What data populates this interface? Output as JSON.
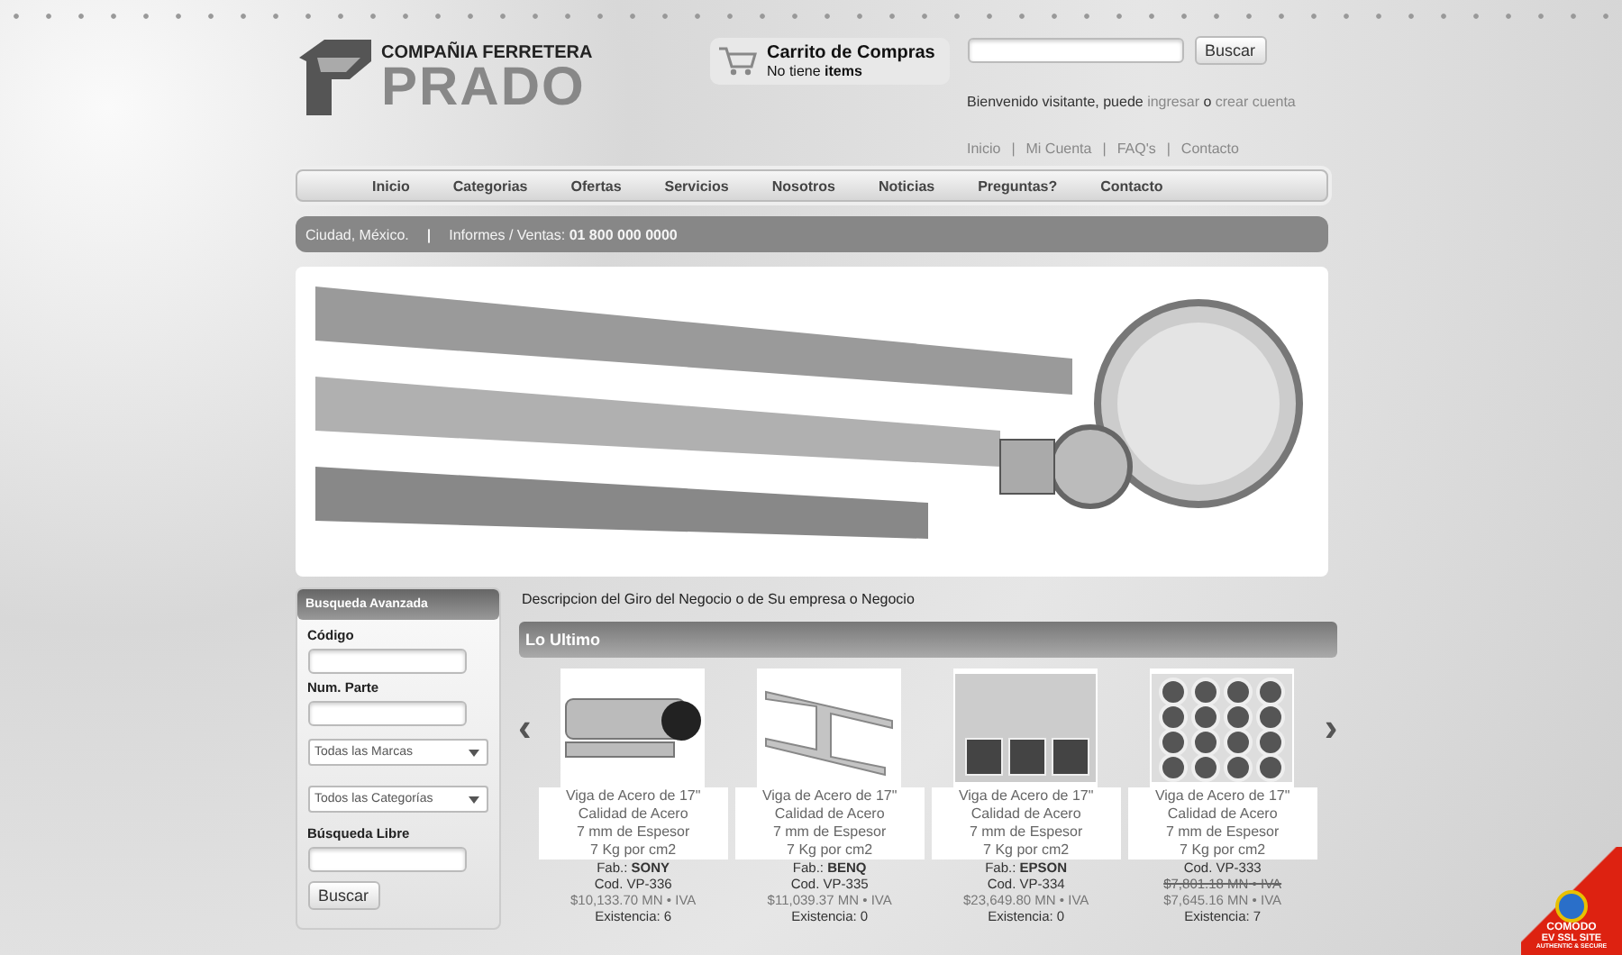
{
  "brand": {
    "line_1": "COMPAÑIA FERRETERA",
    "line_2": "PRADO"
  },
  "cart": {
    "title": "Carrito de Compras",
    "text": "No tiene ",
    "strong": "items"
  },
  "search": {
    "button": "Buscar"
  },
  "welcome": {
    "text": "Bienvenido visitante, puede ",
    "login": "ingresar",
    "joiner": " o ",
    "signup": "crear cuenta"
  },
  "top_links": [
    {
      "kind": "link",
      "text": "Inicio"
    },
    {
      "kind": "separator",
      "text": "|"
    },
    {
      "kind": "link",
      "text": "Mi Cuenta"
    },
    {
      "kind": "separator",
      "text": "|"
    },
    {
      "kind": "link",
      "text": "FAQ's"
    },
    {
      "kind": "separator",
      "text": "|"
    },
    {
      "kind": "link",
      "text": "Contacto"
    }
  ],
  "nav": [
    "Inicio",
    "Categorias",
    "Ofertas",
    "Servicios",
    "Nosotros",
    "Noticias",
    "Preguntas?",
    "Contacto"
  ],
  "info_bar": {
    "city": "Ciudad, México.",
    "separator": "|",
    "label": "Informes / Ventas: ",
    "phone": "01 800 000 0000"
  },
  "advanced_search": {
    "title": "Busqueda Avanzada",
    "fields": [
      {
        "kind": "text",
        "label": "Código"
      },
      {
        "kind": "text",
        "label": "Num. Parte"
      },
      {
        "kind": "select",
        "value": "Todas las Marcas"
      },
      {
        "kind": "select",
        "value": "Todos las Categorías"
      },
      {
        "kind": "text",
        "label": "Búsqueda Libre"
      }
    ],
    "button": "Buscar"
  },
  "description": "Descripcion del Giro del Negocio o de Su empresa o Negocio",
  "latest": {
    "title": "Lo Ultimo",
    "prev": "‹",
    "next": "›",
    "products": [
      {
        "kind": "tubes",
        "lines": [
          "Viga de Acero de 17\"",
          "Calidad de Acero",
          "7 mm de Espesor",
          "7 Kg por cm2"
        ],
        "fab_label": "Fab.: ",
        "fab": "SONY",
        "code": "Cod. VP-336",
        "price": "$10,133.70 MN",
        "tax": " • IVA",
        "stock": "Existencia: 6"
      },
      {
        "kind": "beam",
        "lines": [
          "Viga de Acero de 17\"",
          "Calidad de Acero",
          "7 mm de Espesor",
          "7 Kg por cm2"
        ],
        "fab_label": "Fab.: ",
        "fab": "BENQ",
        "code": "Cod. VP-335",
        "price": "$11,039.37 MN",
        "tax": " • IVA",
        "stock": "Existencia: 0"
      },
      {
        "kind": "square",
        "lines": [
          "Viga de Acero de 17\"",
          "Calidad de Acero",
          "7 mm de Espesor",
          "7 Kg por cm2"
        ],
        "fab_label": "Fab.: ",
        "fab": "EPSON",
        "code": "Cod. VP-334",
        "price": "$23,649.80 MN",
        "tax": " • IVA",
        "stock": "Existencia: 0"
      },
      {
        "kind": "pipes",
        "lines": [
          "Viga de Acero de 17\"",
          "Calidad de Acero",
          "7 mm de Espesor",
          "7 Kg por cm2"
        ],
        "code": "Cod. VP-333",
        "old_price": "$7,801.18 MN",
        "old_tax": " • IVA",
        "price": "$7,645.16 MN",
        "tax": " • IVA",
        "stock": "Existencia: 7"
      }
    ]
  },
  "ssl_badge": {
    "brand": "COMODO",
    "title": "EV SSL SITE",
    "subtitle": "AUTHENTIC & SECURE"
  }
}
